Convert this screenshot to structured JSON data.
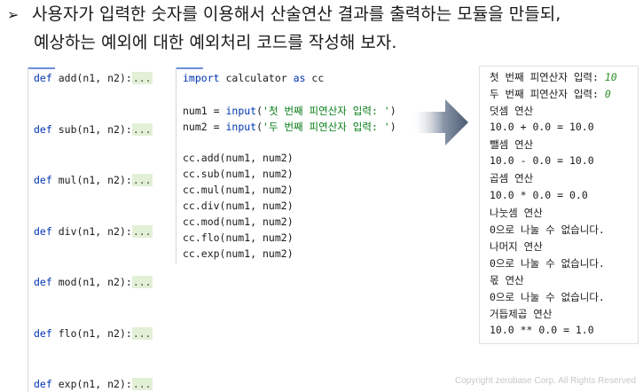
{
  "heading": {
    "bullet": "➢",
    "line1": "사용자가 입력한 숫자를 이용해서 산술연산 결과를 출력하는 모듈을 만들되,",
    "line2": "예상하는 예외에 대한 예외처리 코드를 작성해 보자."
  },
  "functions": [
    {
      "keyword": "def",
      "name": "add",
      "params": "(n1, n2):",
      "folded": "..."
    },
    {
      "keyword": "def",
      "name": "sub",
      "params": "(n1, n2):",
      "folded": "..."
    },
    {
      "keyword": "def",
      "name": "mul",
      "params": "(n1, n2):",
      "folded": "..."
    },
    {
      "keyword": "def",
      "name": "div",
      "params": "(n1, n2):",
      "folded": "..."
    },
    {
      "keyword": "def",
      "name": "mod",
      "params": "(n1, n2):",
      "folded": "..."
    },
    {
      "keyword": "def",
      "name": "flo",
      "params": "(n1, n2):",
      "folded": "..."
    },
    {
      "keyword": "def",
      "name": "exp",
      "params": "(n1, n2):",
      "folded": "..."
    }
  ],
  "code": {
    "import_kw": "import",
    "import_mod": " calculator ",
    "as_kw": "as",
    "alias": " cc",
    "num1_pre": "num1 = ",
    "num1_fn": "input",
    "num1_open": "(",
    "num1_str": "'첫 번째 피연산자 입력: '",
    "num1_close": ")",
    "num2_pre": "num2 = ",
    "num2_fn": "input",
    "num2_open": "(",
    "num2_str": "'두 번째 피연산자 입력: '",
    "num2_close": ")",
    "calls": [
      "cc.add(num1, num2)",
      "cc.sub(num1, num2)",
      "cc.mul(num1, num2)",
      "cc.div(num1, num2)",
      "cc.mod(num1, num2)",
      "cc.flo(num1, num2)",
      "cc.exp(num1, num2)"
    ]
  },
  "output": {
    "prompt1": "첫 번째 피연산자 입력: ",
    "input1": "10",
    "prompt2": "두 번째 피연산자 입력: ",
    "input2": "0",
    "lines": [
      "덧셈 연산",
      "10.0 + 0.0 = 10.0",
      "뺄셈 연산",
      "10.0 - 0.0 = 10.0",
      "곱셈 연산",
      "10.0 * 0.0 = 0.0",
      "나눗셈 연산",
      "0으로 나눌 수 없습니다.",
      "나머지 연산",
      "0으로 나눌 수 없습니다.",
      "몫 연산",
      "0으로 나눌 수 없습니다.",
      "거듭제곱 연산",
      "10.0 ** 0.0 = 1.0"
    ]
  },
  "arrow_icon": "right-arrow-icon",
  "colors": {
    "keyword": "#0033b3",
    "string": "#067d17",
    "input": "#2f8f2f",
    "arrow": "#4a5a72"
  },
  "copyright": "Copyright zerobase Corp. All Rights Reserved"
}
